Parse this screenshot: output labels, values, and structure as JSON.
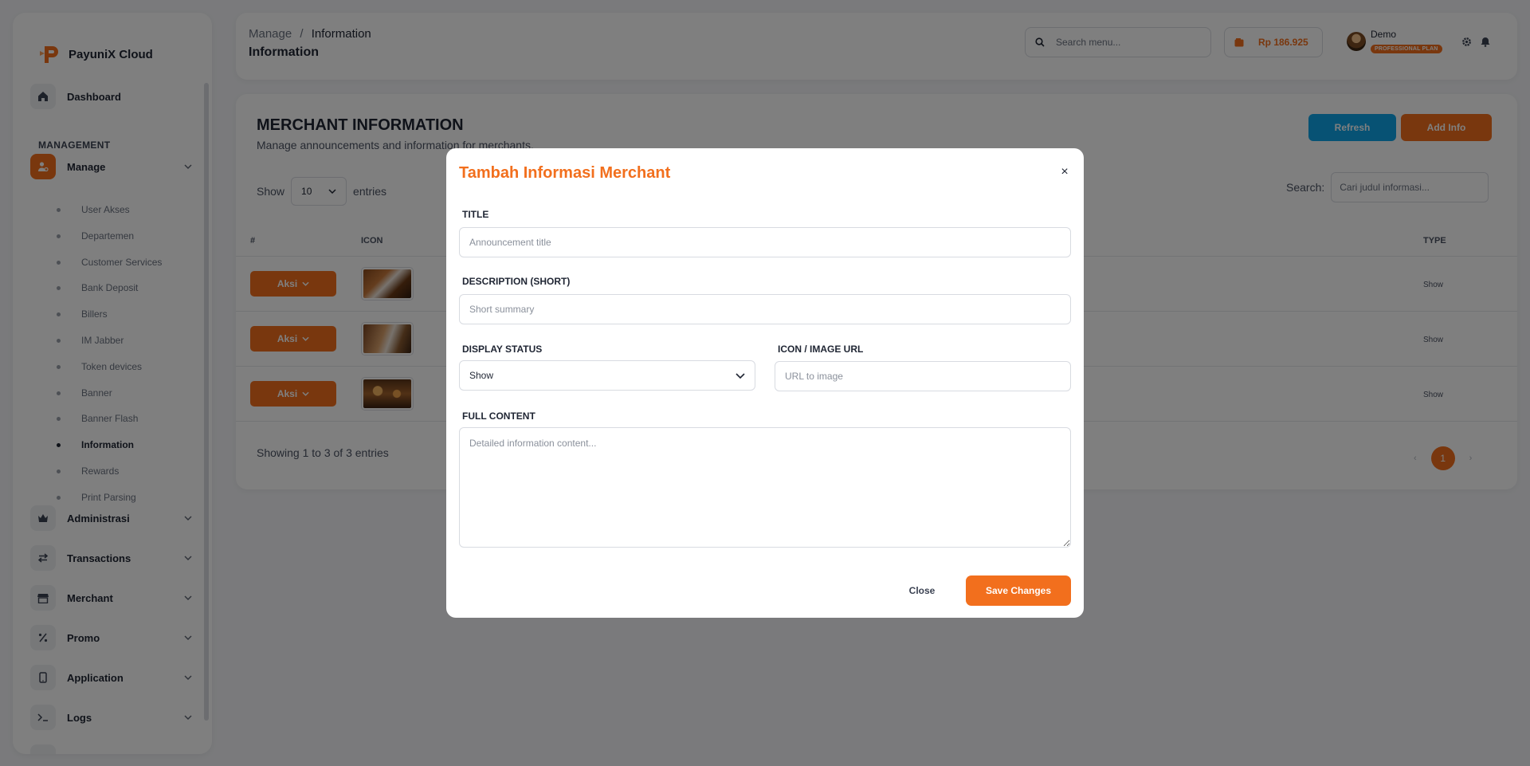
{
  "brand": {
    "name": "PayuniX Cloud"
  },
  "sidebar": {
    "dashboard": "Dashboard",
    "section": "MANAGEMENT",
    "manage": "Manage",
    "sub_items": [
      "User Akses",
      "Departemen",
      "Customer Services",
      "Bank Deposit",
      "Billers",
      "IM Jabber",
      "Token devices",
      "Banner",
      "Banner Flash",
      "Information",
      "Rewards",
      "Print Parsing"
    ],
    "active_sub": "Information",
    "groups": [
      "Administrasi",
      "Transactions",
      "Merchant",
      "Promo",
      "Application",
      "Logs"
    ]
  },
  "header": {
    "breadcrumb_parent": "Manage",
    "breadcrumb_sep": "/",
    "breadcrumb_current": "Information",
    "title": "Information",
    "search_placeholder": "Search menu...",
    "balance": "Rp 186.925",
    "user_name": "Demo",
    "user_plan": "PROFESSIONAL PLAN"
  },
  "card": {
    "title": "MERCHANT INFORMATION",
    "subtitle": "Manage announcements and information for merchants.",
    "refresh_label": "Refresh",
    "add_label": "Add Info",
    "show_label": "Show",
    "entries_value": "10",
    "entries_label": "entries",
    "search_label": "Search:",
    "search_placeholder": "Cari judul informasi...",
    "columns": [
      "#",
      "ICON",
      "TYPE"
    ],
    "rows": [
      {
        "action": "Aksi",
        "type": "Show"
      },
      {
        "action": "Aksi",
        "type": "Show"
      },
      {
        "action": "Aksi",
        "type": "Show"
      }
    ],
    "showing": "Showing 1 to 3 of 3 entries",
    "page": "1",
    "prev": "‹",
    "next": "›"
  },
  "modal": {
    "title": "Tambah Informasi Merchant",
    "close_x": "×",
    "title_label": "TITLE",
    "title_placeholder": "Announcement title",
    "desc_label": "DESCRIPTION (SHORT)",
    "desc_placeholder": "Short summary",
    "status_label": "DISPLAY STATUS",
    "status_value": "Show",
    "icon_label": "ICON / IMAGE URL",
    "icon_placeholder": "URL to image",
    "content_label": "FULL CONTENT",
    "content_placeholder": "Detailed information content...",
    "close_label": "Close",
    "save_label": "Save Changes"
  },
  "colors": {
    "accent": "#f26f1d",
    "info": "#0ea5e9"
  }
}
